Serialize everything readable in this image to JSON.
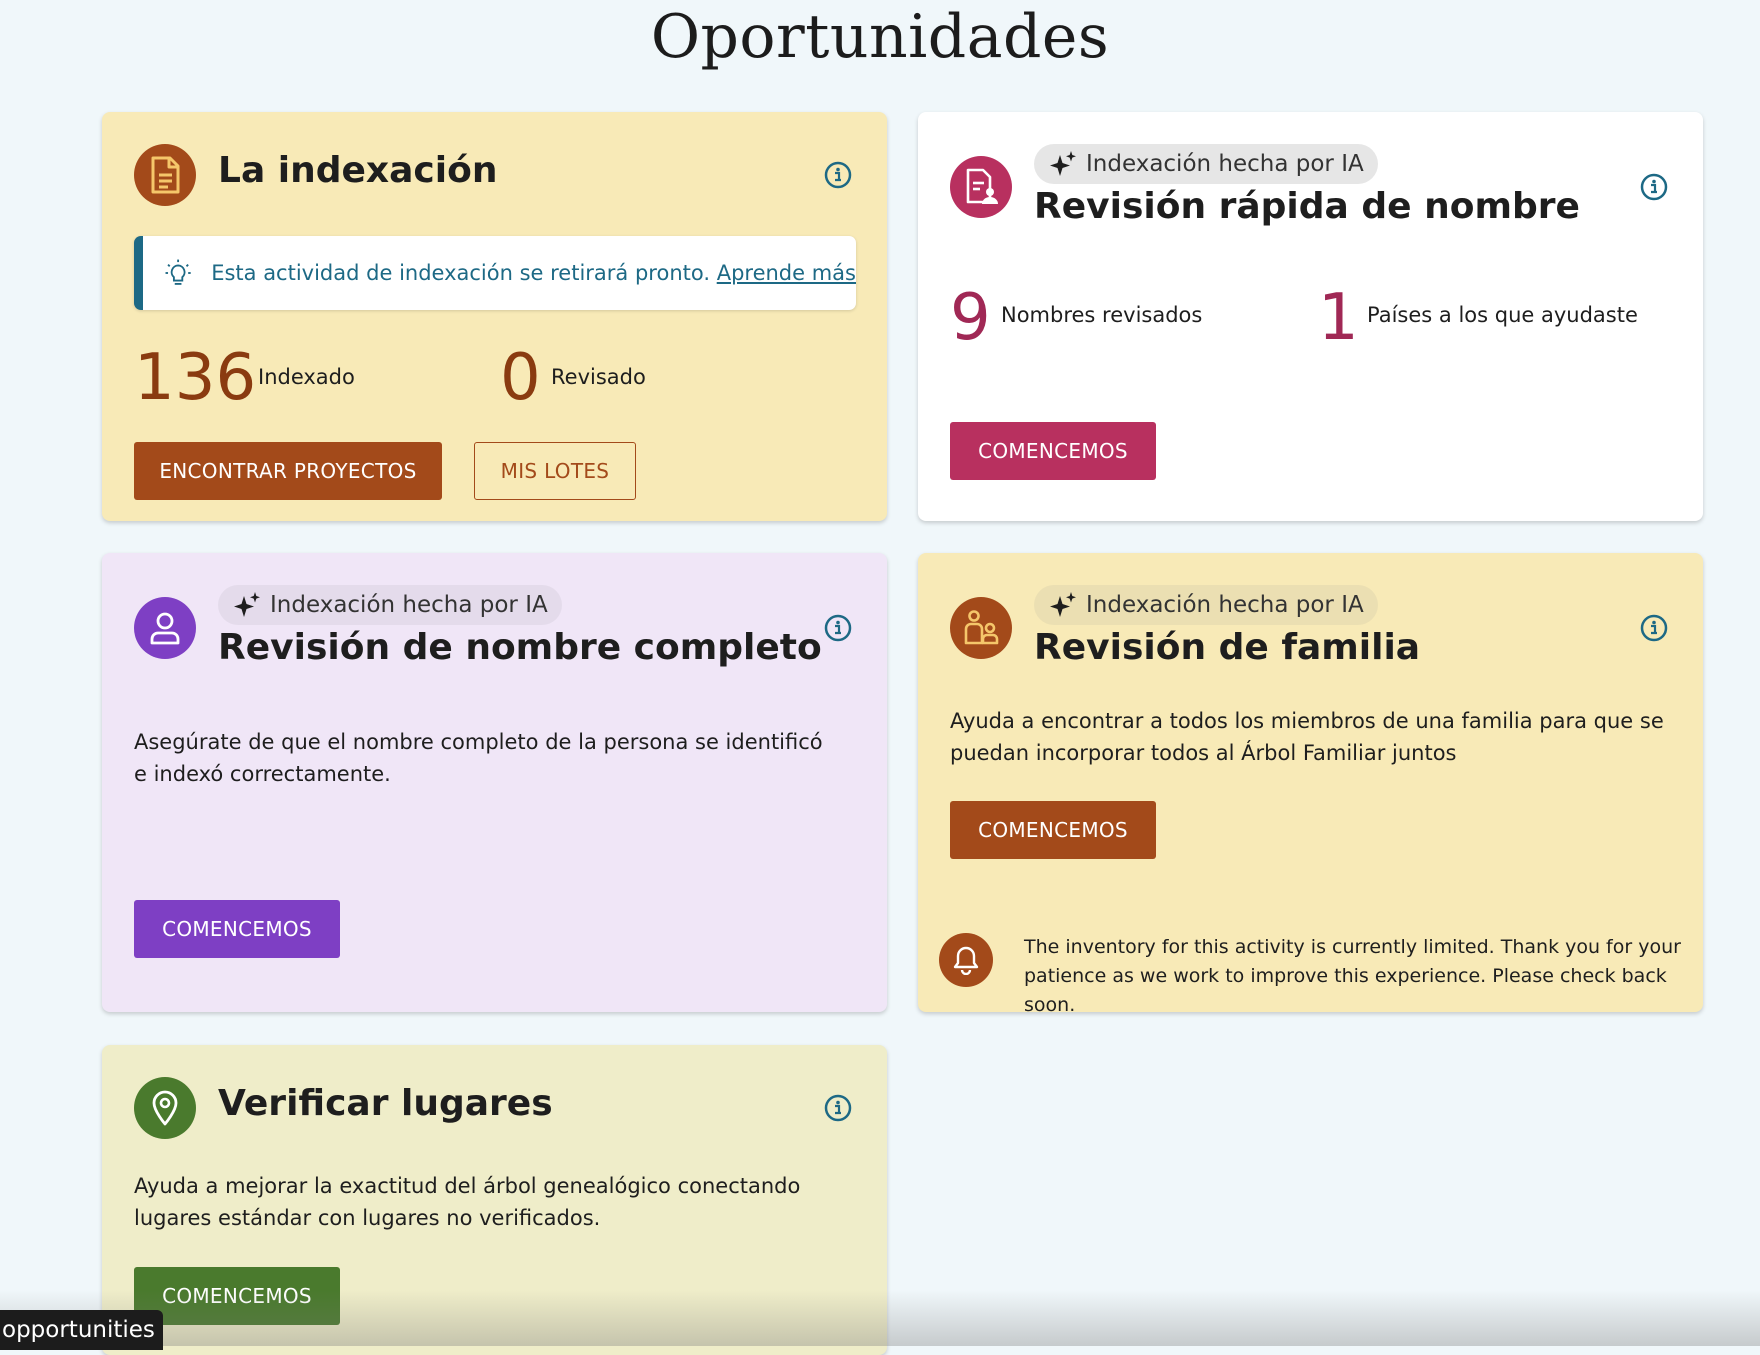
{
  "page": {
    "title": "Oportunidades"
  },
  "colors": {
    "rust": "#a34a1a",
    "crimson": "#b8305f",
    "purple": "#7e3fc4",
    "green": "#4a7a2d",
    "teal": "#1d6985"
  },
  "indexing": {
    "title": "La indexación",
    "icon": "document-icon",
    "notice": {
      "text": "Esta actividad de indexación se retirará pronto. ",
      "link": "Aprende más"
    },
    "stats": [
      {
        "value": "136",
        "label": "Indexado"
      },
      {
        "value": "0",
        "label": "Revisado"
      }
    ],
    "primary_button": "ENCONTRAR PROYECTOS",
    "secondary_button": "MIS LOTES"
  },
  "quick_name": {
    "badge": "Indexación hecha por IA",
    "title": "Revisión rápida de nombre",
    "icon": "document-person-icon",
    "stats": [
      {
        "value": "9",
        "label": "Nombres revisados"
      },
      {
        "value": "1",
        "label": "Países a los que ayudaste"
      }
    ],
    "button": "COMENCEMOS"
  },
  "full_name": {
    "badge": "Indexación hecha por IA",
    "title": "Revisión de nombre completo",
    "icon": "person-icon",
    "description": "Asegúrate de que el nombre completo de la persona se identificó e indexó correctamente.",
    "button": "COMENCEMOS"
  },
  "family": {
    "badge": "Indexación hecha por IA",
    "title": "Revisión de familia",
    "icon": "family-icon",
    "description": "Ayuda a encontrar a todos los miembros de una familia para que se puedan incorporar todos al Árbol Familiar juntos",
    "button": "COMENCEMOS",
    "notice": "The inventory for this activity is currently limited. Thank you for your patience as we work to improve this experience. Please check back soon."
  },
  "places": {
    "title": "Verificar lugares",
    "icon": "location-pin-icon",
    "description": "Ayuda a mejorar la exactitud del árbol genealógico conectando lugares estándar con lugares no verificados.",
    "button": "COMENCEMOS"
  },
  "tooltip": {
    "text": "opportunities"
  }
}
